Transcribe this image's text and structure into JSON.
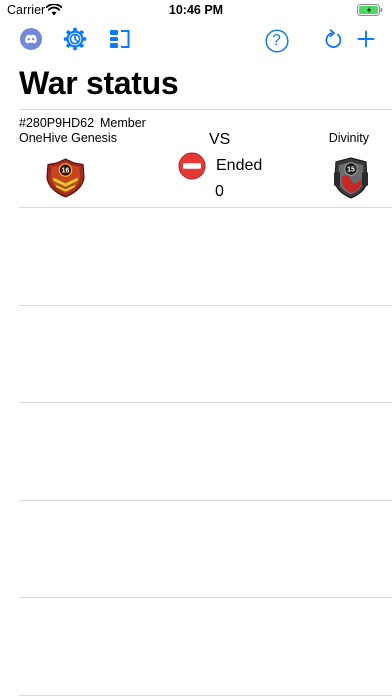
{
  "status_bar": {
    "carrier": "Carrier",
    "time": "10:46 PM"
  },
  "nav": {
    "left_icons": [
      "discord-icon",
      "gear-icon",
      "layout-icon"
    ],
    "right_icons": [
      "help-icon",
      "refresh-icon",
      "add-icon"
    ],
    "help_label": "?"
  },
  "page": {
    "title": "War status"
  },
  "wars": [
    {
      "clan_tag": "#280P9HD62",
      "role": "Member",
      "home_clan": "OneHive Genesis",
      "home_badge_level": "16",
      "vs_label": "VS",
      "state": "Ended",
      "state_icon": "no-entry-icon",
      "score": "0",
      "opponent_clan": "Divinity",
      "opponent_badge_level": "15"
    }
  ],
  "colors": {
    "accent": "#0a7aff",
    "discord": "#7289da",
    "state_red": "#e53935",
    "separator": "#d9d9de",
    "battery_green": "#4cd964"
  }
}
